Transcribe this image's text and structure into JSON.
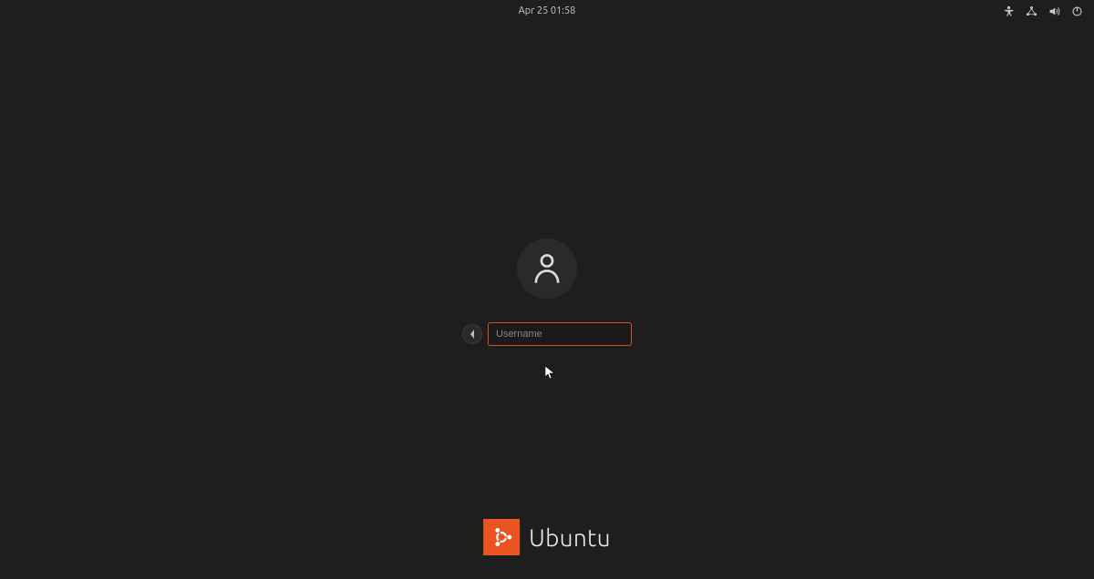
{
  "topbar": {
    "datetime": "Apr 25  01:58"
  },
  "login": {
    "username_placeholder": "Username",
    "username_value": ""
  },
  "branding": {
    "name": "Ubuntu"
  },
  "colors": {
    "accent": "#e95420",
    "input_border": "#d85020",
    "background": "#1e1e1e"
  }
}
